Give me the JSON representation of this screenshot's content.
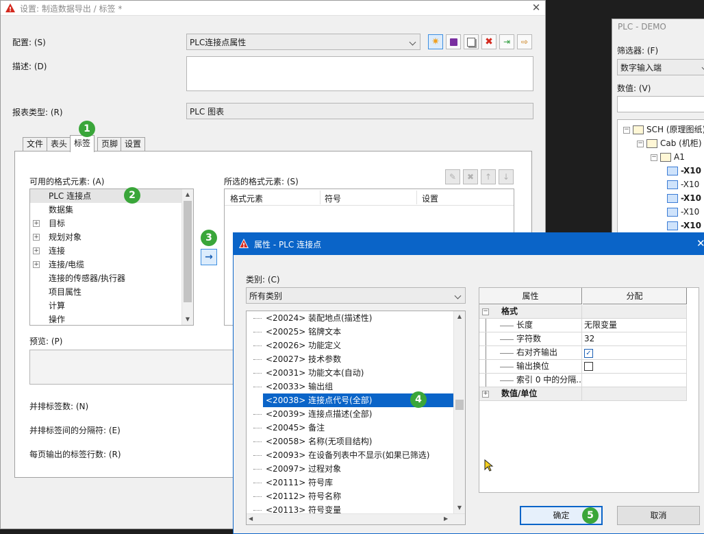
{
  "main_dialog": {
    "title": "设置: 制造数据导出 / 标签 *",
    "config_label": "配置: (S)",
    "config_value": "PLC连接点属性",
    "desc_label": "描述: (D)",
    "desc_value": "",
    "report_type_label": "报表类型: (R)",
    "report_type_value": "PLC 图表",
    "tabs": [
      "文件",
      "表头",
      "标签",
      "页脚",
      "设置"
    ],
    "available_label": "可用的格式元素: (A)",
    "available_items": [
      {
        "text": "PLC 连接点",
        "expander": false,
        "selected": true
      },
      {
        "text": "数据集",
        "expander": false
      },
      {
        "text": "目标",
        "expander": true
      },
      {
        "text": "规划对象",
        "expander": true
      },
      {
        "text": "连接",
        "expander": true
      },
      {
        "text": "连接/电缆",
        "expander": true
      },
      {
        "text": "连接的传感器/执行器",
        "expander": false
      },
      {
        "text": "项目属性",
        "expander": false
      },
      {
        "text": "计算",
        "expander": false
      },
      {
        "text": "操作",
        "expander": false
      }
    ],
    "selected_label": "所选的格式元素: (S)",
    "selected_columns": [
      "格式元素",
      "符号",
      "设置"
    ],
    "preview_label": "预览: (P)",
    "side_by_side_label": "并排标签数: (N)",
    "separator_label": "并排标签间的分隔符: (E)",
    "rows_per_page_label": "每页输出的标签行数: (R)",
    "transfer_arrow": "→"
  },
  "plc_panel": {
    "title": "PLC - DEMO",
    "filter_label": "筛选器: (F)",
    "filter_value": "数字输入端",
    "value_label": "数值: (V)",
    "tree": [
      {
        "text": "SCH (原理图纸)",
        "level": 0,
        "bold": false
      },
      {
        "text": "Cab (机柜)",
        "level": 1,
        "bold": false
      },
      {
        "text": "A1",
        "level": 2,
        "bold": false
      },
      {
        "text": "-X10",
        "level": 3,
        "bold": true
      },
      {
        "text": "-X10",
        "level": 3,
        "bold": false
      },
      {
        "text": "-X10",
        "level": 3,
        "bold": true
      },
      {
        "text": "-X10",
        "level": 3,
        "bold": false
      },
      {
        "text": "-X10",
        "level": 3,
        "bold": true
      }
    ]
  },
  "props_dialog": {
    "title": "属性 - PLC 连接点",
    "category_label": "类别: (C)",
    "category_value": "所有类别",
    "list": [
      "<20024> 装配地点(描述性)",
      "<20025> 铭牌文本",
      "<20026> 功能定义",
      "<20027> 技术参数",
      "<20031> 功能文本(自动)",
      "<20033> 输出组",
      "<20038> 连接点代号(全部)",
      "<20039> 连接点描述(全部)",
      "<20045> 备注",
      "<20058> 名称(无项目结构)",
      "<20093> 在设备列表中不显示(如果已筛选)",
      "<20097> 过程对象",
      "<20111> 符号库",
      "<20112> 符号名称",
      "<20113> 符号变量"
    ],
    "selected_index": 6,
    "grid_headers": [
      "属性",
      "分配"
    ],
    "grid_rows": [
      {
        "name": "格式",
        "value": "",
        "group": true,
        "expander": "−"
      },
      {
        "name": "长度",
        "value": "无限变量",
        "group": false
      },
      {
        "name": "字符数",
        "value": "32",
        "group": false
      },
      {
        "name": "右对齐输出",
        "value": "checked",
        "group": false
      },
      {
        "name": "输出换位",
        "value": "unchecked",
        "group": false
      },
      {
        "name": "索引 0 中的分隔...",
        "value": "",
        "group": false
      },
      {
        "name": "数值/单位",
        "value": "",
        "group": true,
        "expander": "+"
      }
    ],
    "ok_label": "确定",
    "cancel_label": "取消"
  },
  "badges": [
    "1",
    "2",
    "3",
    "4",
    "5"
  ],
  "colors": {
    "accent": "#0a64c8",
    "badge": "#3aa63a",
    "selection": "#0a64c8",
    "warning_icon": "#d42a1f"
  }
}
